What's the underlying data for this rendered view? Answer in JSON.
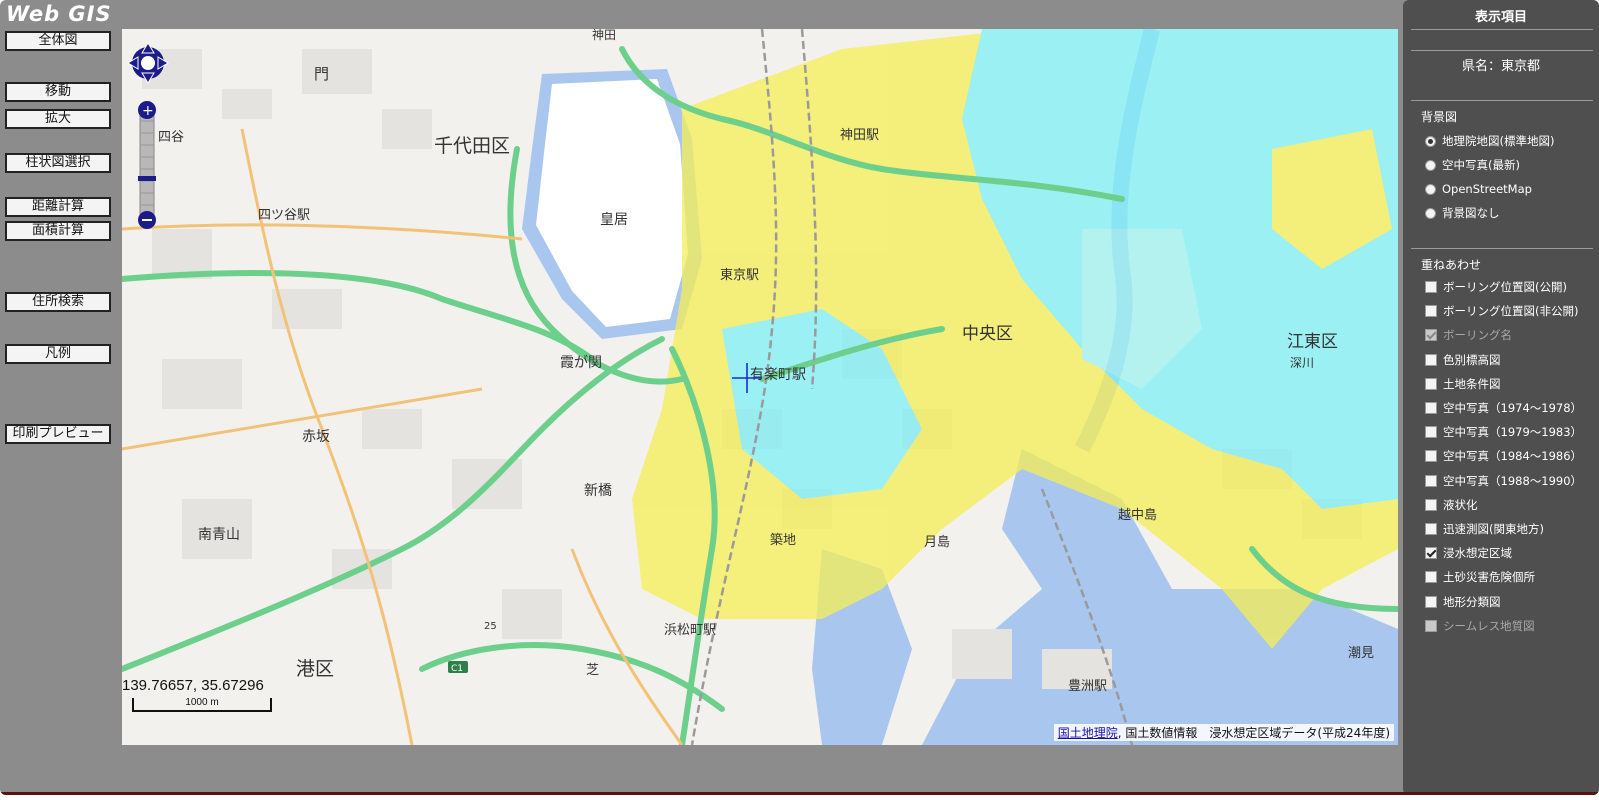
{
  "app": {
    "logo": "Web GIS"
  },
  "toolbar": {
    "zenntai": "全体図",
    "idou": "移動",
    "kakudai": "拡大",
    "chuujouzu": "柱状図選択",
    "kyori": "距離計算",
    "menseki": "面積計算",
    "juusho": "住所検索",
    "hanrei": "凡例",
    "insatsu": "印刷プレビュー"
  },
  "map": {
    "coords": "139.76657, 35.67296",
    "scale": "1000 m",
    "attribution": {
      "link": "国土地理院",
      "rest": ", 国土数値情報　浸水想定区域データ(平成24年度)"
    },
    "colors": {
      "flood_yellow": "#f5ee55",
      "flood_cyan": "#7ff0f5",
      "river": "#a9c6ee",
      "road": "#6ccf8b",
      "palace": "#ffffff"
    },
    "labels": {
      "chiyoda": "千代田区",
      "koukyo": "皇居",
      "yotsuya_station": "四ツ谷駅",
      "yotsuya": "四谷",
      "akasaka": "赤坂",
      "minamiaoyama": "南青山",
      "minato": "港区",
      "kasumigaseki": "霞が関",
      "shinbashi": "新橋",
      "yurakucho": "有楽町駅",
      "tokyo_station": "東京駅",
      "kanda": "神田駅",
      "chuo": "中央区",
      "koto": "江東区",
      "tsukishima": "月島",
      "toyosu": "豊洲駅",
      "hamamatsucho": "浜松町駅",
      "tsukiji": "築地",
      "shiba": "芝",
      "ecchujima": "越中島",
      "shiomi": "潮見",
      "kanda_top": "神田",
      "fukagawa": "深川",
      "monzen": "門",
      "route_c1": "C1",
      "route_25": "25"
    }
  },
  "panel": {
    "title": "表示項目",
    "pref": "県名：東京都",
    "background_title": "背景図",
    "background": [
      {
        "label": "地理院地図(標準地図)",
        "checked": true
      },
      {
        "label": "空中写真(最新)",
        "checked": false
      },
      {
        "label": "OpenStreetMap",
        "checked": false
      },
      {
        "label": "背景図なし",
        "checked": false
      }
    ],
    "overlay_title": "重ねあわせ",
    "overlays": [
      {
        "label": "ボーリング位置図(公開)",
        "checked": false,
        "disabled": false
      },
      {
        "label": "ボーリング位置図(非公開)",
        "checked": false,
        "disabled": false
      },
      {
        "label": "ボーリング名",
        "checked": true,
        "disabled": true
      },
      {
        "label": "色別標高図",
        "checked": false,
        "disabled": false
      },
      {
        "label": "土地条件図",
        "checked": false,
        "disabled": false
      },
      {
        "label": "空中写真（1974～1978）",
        "checked": false,
        "disabled": false
      },
      {
        "label": "空中写真（1979～1983）",
        "checked": false,
        "disabled": false
      },
      {
        "label": "空中写真（1984～1986）",
        "checked": false,
        "disabled": false
      },
      {
        "label": "空中写真（1988～1990）",
        "checked": false,
        "disabled": false
      },
      {
        "label": "液状化",
        "checked": false,
        "disabled": false
      },
      {
        "label": "迅速測図(関東地方)",
        "checked": false,
        "disabled": false
      },
      {
        "label": "浸水想定区域",
        "checked": true,
        "disabled": false
      },
      {
        "label": "土砂災害危険個所",
        "checked": false,
        "disabled": false
      },
      {
        "label": "地形分類図",
        "checked": false,
        "disabled": false
      },
      {
        "label": "シームレス地質図",
        "checked": false,
        "disabled": true
      }
    ]
  }
}
